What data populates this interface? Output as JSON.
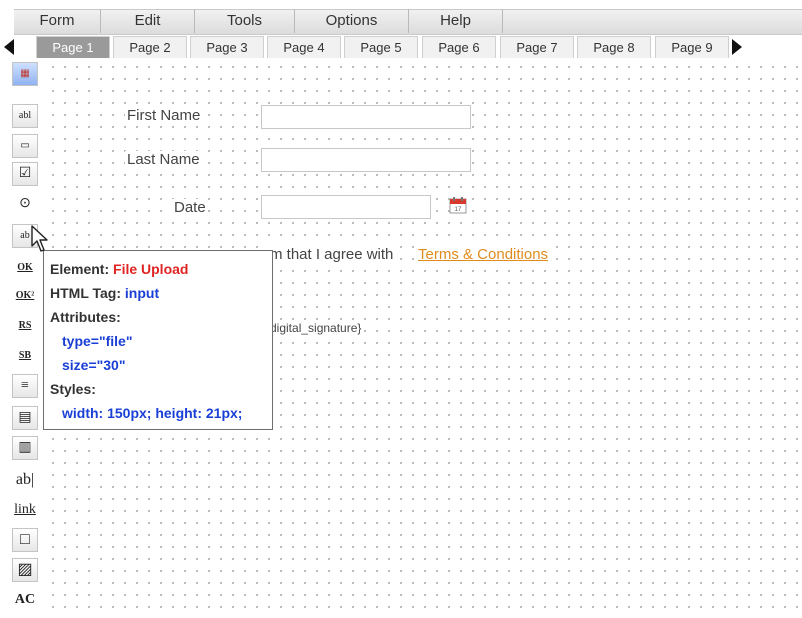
{
  "menu": [
    "Form",
    "Edit",
    "Tools",
    "Options",
    "Help"
  ],
  "tabs": [
    "Page 1",
    "Page 2",
    "Page 3",
    "Page 4",
    "Page 5",
    "Page 6",
    "Page 7",
    "Page 8",
    "Page 9"
  ],
  "active_tab": "Page 1",
  "toolbar": {
    "tools": [
      {
        "name": "form-properties-icon",
        "glyph": "▦"
      },
      {
        "name": "textbox-icon",
        "glyph": "abl"
      },
      {
        "name": "textarea-icon",
        "glyph": "▭"
      },
      {
        "name": "checkbox-icon",
        "glyph": "☑"
      },
      {
        "name": "radio-icon",
        "glyph": "⊙"
      },
      {
        "name": "file-upload-icon",
        "glyph": "ab"
      },
      {
        "name": "button-ok-icon",
        "glyph": "OK"
      },
      {
        "name": "button-ok2-icon",
        "glyph": "OK²"
      },
      {
        "name": "reset-button-icon",
        "glyph": "RS"
      },
      {
        "name": "submit-button-icon",
        "glyph": "SB"
      },
      {
        "name": "list-icon",
        "glyph": "≡"
      },
      {
        "name": "dropdown-icon",
        "glyph": "▤"
      },
      {
        "name": "listbox-icon",
        "glyph": "▥"
      },
      {
        "name": "label-icon",
        "glyph": "ab|"
      },
      {
        "name": "link-icon",
        "glyph": "link"
      },
      {
        "name": "panel-icon",
        "glyph": "□"
      },
      {
        "name": "image-icon",
        "glyph": "▨"
      },
      {
        "name": "captcha-icon",
        "glyph": "AC"
      }
    ]
  },
  "form": {
    "first_name_label": "First Name",
    "last_name_label": "Last Name",
    "date_label": "Date",
    "agree_text": "m that I agree with",
    "terms_link": "Terms & Conditions",
    "signature_placeholder": "digital_signature}"
  },
  "tooltip": {
    "element_label": "Element:",
    "element_value": "File Upload",
    "tag_label": "HTML Tag:",
    "tag_value": "input",
    "attributes_label": "Attributes:",
    "attributes": [
      "type=\"file\"",
      "size=\"30\""
    ],
    "styles_label": "Styles:",
    "styles_value": "width: 150px; height: 21px;"
  },
  "colors": {
    "link": "#e08b1e",
    "tooltip_red": "#e02424",
    "tooltip_blue": "#1a3fd6"
  }
}
